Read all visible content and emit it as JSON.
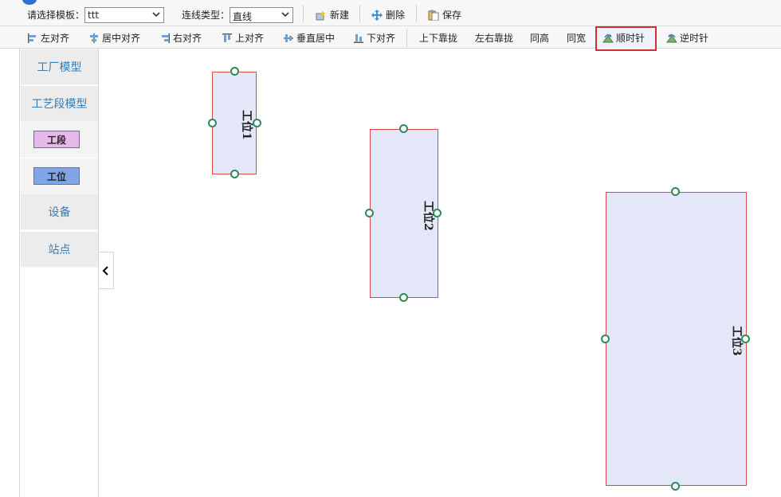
{
  "toolbar": {
    "template_label": "请选择模板：",
    "template_value": "ttt",
    "link_type_label": "连线类型：",
    "link_type_value": "直线",
    "new_label": "新建",
    "delete_label": "删除",
    "save_label": "保存"
  },
  "align_toolbar": {
    "left_align": "左对齐",
    "center_align": "居中对齐",
    "right_align": "右对齐",
    "top_align": "上对齐",
    "vertical_center": "垂直居中",
    "bottom_align": "下对齐",
    "vertical_distribute": "上下靠拢",
    "horizontal_distribute": "左右靠拢",
    "same_height": "同高",
    "same_width": "同宽",
    "clockwise": "顺时针",
    "counterclockwise": "逆时针"
  },
  "sidebar": {
    "items": [
      {
        "label": "工厂模型"
      },
      {
        "label": "工艺段模型"
      },
      {
        "label": "工段",
        "color": "#e8b8ea"
      },
      {
        "label": "工位",
        "color": "#7ea6e8"
      },
      {
        "label": "设备"
      },
      {
        "label": "站点"
      }
    ]
  },
  "canvas": {
    "nodes": [
      {
        "label": "工位1"
      },
      {
        "label": "工位2"
      },
      {
        "label": "工位3"
      }
    ]
  },
  "colors": {
    "node_fill": "#e4e7f7",
    "node_border": "#e0474c",
    "port": "#2e8a55",
    "accent": "#3a7bb0",
    "highlight": "#d32f2f"
  }
}
